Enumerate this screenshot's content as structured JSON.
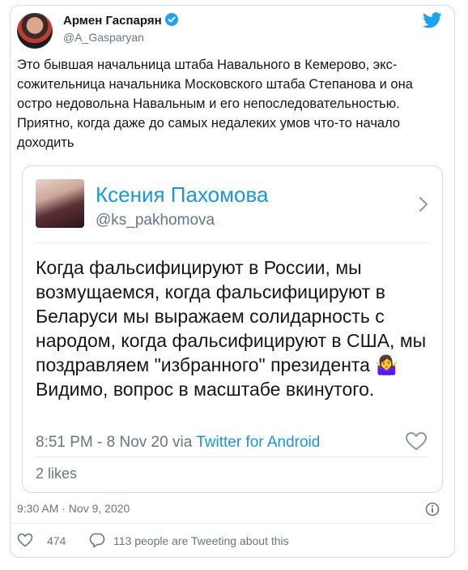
{
  "tweet": {
    "author_name": "Армен Гаспарян",
    "handle": "@A_Gasparyan",
    "text": "Это бывшая начальница штаба Навального в Кемерово, экс-сожительница начальника Московского штаба Степанова и она остро недовольна Навальным и его непоследовательностью. Приятно, когда даже до самых недалеких умов что-то начало доходить",
    "date": "9:30 AM · Nov 9, 2020",
    "likes": "474",
    "conversation": "113 people are Tweeting about this"
  },
  "quoted": {
    "author_name": "Ксения Пахомова",
    "handle": "@ks_pakhomova",
    "text_main": "Когда фальсифицируют в России, мы возмущаемся, когда фальсифицируют в Беларуси мы выражаем солидарность с народом, когда фальсифицируют в США, мы поздравляем \"избранного\" президента ",
    "emoji": "🤷‍♀️",
    "text_end": "Видимо, вопрос в масштабе вкинутого.",
    "timestamp": "8:51 PM - 8 Nov 20 via ",
    "via": "Twitter for Android",
    "likes": "2 likes"
  },
  "icons": [
    "verified-badge-icon",
    "twitter-bird-icon",
    "chevron-right-icon",
    "heart-icon",
    "info-icon",
    "reply-bubble-icon"
  ],
  "colors": {
    "link": "#1b95e0",
    "muted": "#657786",
    "border": "#d4dbe1",
    "verified": "#1da1f2"
  }
}
